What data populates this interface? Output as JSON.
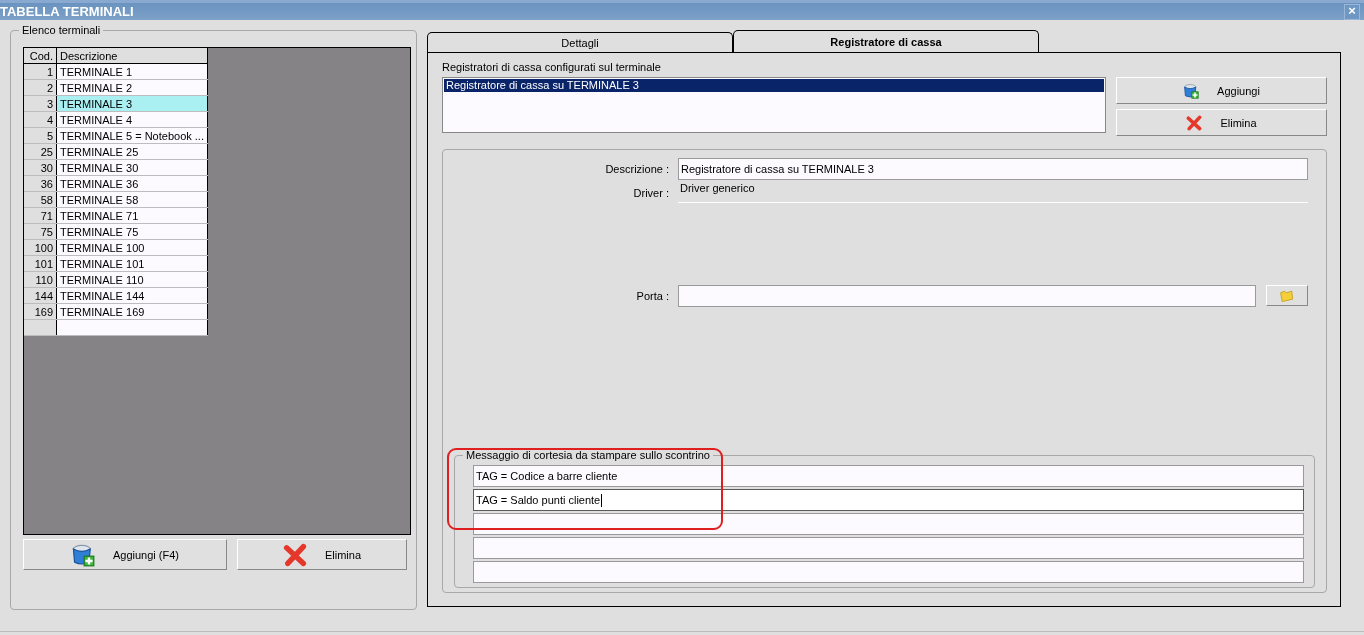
{
  "window": {
    "title": "TABELLA TERMINALI",
    "close": "×"
  },
  "terminal_list": {
    "title": "Elenco terminali",
    "columns": [
      "Cod.",
      "Descrizione"
    ],
    "rows": [
      {
        "code": "1",
        "description": "TERMINALE 1",
        "selected": false
      },
      {
        "code": "2",
        "description": "TERMINALE 2",
        "selected": false
      },
      {
        "code": "3",
        "description": "TERMINALE 3",
        "selected": true
      },
      {
        "code": "4",
        "description": "TERMINALE 4",
        "selected": false
      },
      {
        "code": "5",
        "description": "TERMINALE 5 = Notebook ...",
        "selected": false
      },
      {
        "code": "25",
        "description": "TERMINALE 25",
        "selected": false
      },
      {
        "code": "30",
        "description": "TERMINALE 30",
        "selected": false
      },
      {
        "code": "36",
        "description": "TERMINALE 36",
        "selected": false
      },
      {
        "code": "58",
        "description": "TERMINALE 58",
        "selected": false
      },
      {
        "code": "71",
        "description": "TERMINALE 71",
        "selected": false
      },
      {
        "code": "75",
        "description": "TERMINALE 75",
        "selected": false
      },
      {
        "code": "100",
        "description": "TERMINALE 100",
        "selected": false
      },
      {
        "code": "101",
        "description": "TERMINALE 101",
        "selected": false
      },
      {
        "code": "110",
        "description": "TERMINALE 110",
        "selected": false
      },
      {
        "code": "144",
        "description": "TERMINALE 144",
        "selected": false
      },
      {
        "code": "169",
        "description": "TERMINALE 169",
        "selected": false
      }
    ],
    "buttons": [
      {
        "kind": "add",
        "label": "Aggiungi (F4)"
      },
      {
        "kind": "delete",
        "label": "Elimina"
      }
    ]
  },
  "tabs": [
    {
      "label": "Dettagli",
      "selected": false
    },
    {
      "label": "Registratore di cassa",
      "selected": true
    }
  ],
  "registers": {
    "label": "Registratori di cassa configurati sul terminale",
    "items": [
      {
        "label": "Registratore di cassa su TERMINALE 3",
        "selected": true
      }
    ],
    "buttons": [
      {
        "kind": "add",
        "label": "Aggiungi"
      },
      {
        "kind": "delete",
        "label": "Elimina"
      }
    ]
  },
  "fields": [
    {
      "label": "Descrizione :",
      "kind": "text",
      "value": "Registratore di cassa su TERMINALE 3"
    },
    {
      "label": "Driver :",
      "kind": "readonly",
      "value": "Driver generico"
    },
    {
      "label": "Porta :",
      "kind": "browse"
    }
  ],
  "courtesy_message": {
    "title": "Messaggio di cortesia da stampare sullo scontrino",
    "highlighted": true,
    "lines": [
      {
        "value": "TAG = Codice a barre cliente",
        "focused": false
      },
      {
        "value": "TAG = Saldo punti cliente",
        "focused": true
      },
      {
        "focused": false
      },
      {
        "focused": false
      },
      {
        "focused": false
      }
    ]
  }
}
